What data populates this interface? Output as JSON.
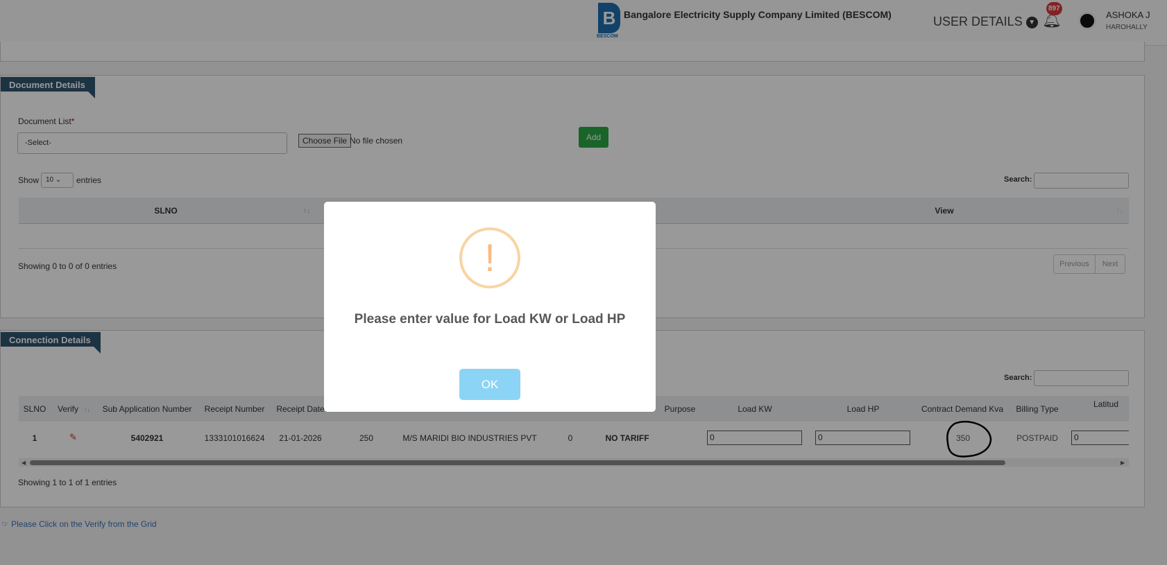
{
  "header": {
    "org_title": "Bangalore Electricity Supply Company Limited (BESCOM)",
    "logo_text": "BESCOM",
    "user_details": "USER DETAILS",
    "notification_count": "897",
    "user_name": "ASHOKA J",
    "user_location": "HAROHALLY"
  },
  "documents": {
    "section_title": "Document Details",
    "list_label": "Document List",
    "required_mark": "*",
    "select_value": "-Select-",
    "choose_file": "Choose File",
    "no_file": "No file chosen",
    "add": "Add",
    "show": "Show",
    "entries_value": "10",
    "entries": "entries",
    "search_label": "Search:",
    "columns": [
      "SLNO",
      "View"
    ],
    "info": "Showing 0 to 0 of 0 entries",
    "previous": "Previous",
    "next": "Next"
  },
  "connection": {
    "section_title": "Connection Details",
    "search_label": "Search:",
    "columns": [
      "SLNO",
      "Verify",
      "Sub Application Number",
      "Receipt Number",
      "Receipt Date",
      "Purpose",
      "Load KW",
      "Load HP",
      "Contract Demand Kva",
      "Billing Type",
      "Latitud"
    ],
    "row": {
      "slno": "1",
      "sub_app": "5402921",
      "receipt_no": "1333101016624",
      "receipt_date": "21-01-2026",
      "c6": "250",
      "name": "M/S MARIDI BIO INDUSTRIES PVT",
      "c8": "0",
      "tariff": "NO TARIFF",
      "load_kw": "0",
      "load_hp": "0",
      "contract_kva": "350",
      "billing": "POSTPAID",
      "latitude": "0"
    },
    "info": "Showing 1 to 1 of 1 entries"
  },
  "hint": "Please Click on the Verify from the Grid",
  "modal": {
    "message": "Please enter value for Load KW or Load HP",
    "ok": "OK",
    "icon": "warning-icon",
    "accent": "#f8bb86"
  }
}
